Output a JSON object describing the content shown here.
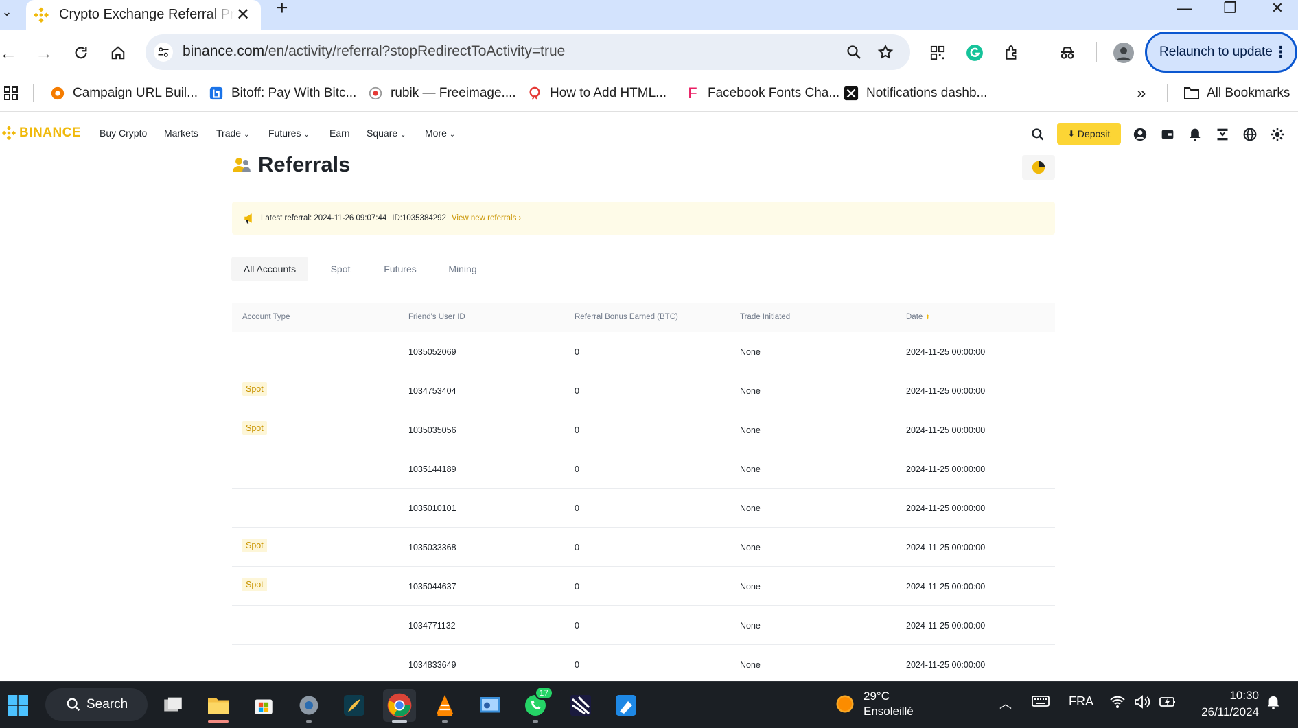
{
  "browser": {
    "tab_title": "Crypto Exchange Referral Program",
    "url_host": "binance.com",
    "url_path": "/en/activity/referral?stopRedirectToActivity=true",
    "relaunch_label": "Relaunch to update",
    "bookmarks": [
      {
        "label": "Campaign URL Buil...",
        "icon": "campaign-icon"
      },
      {
        "label": "Bitoff: Pay With Bitc...",
        "icon": "bitoff-icon"
      },
      {
        "label": "rubik — Freeimage....",
        "icon": "freeimage-icon"
      },
      {
        "label": "How to Add HTML...",
        "icon": "html-icon"
      },
      {
        "label": "Facebook Fonts Cha...",
        "icon": "fonts-icon"
      },
      {
        "label": "Notifications dashb...",
        "icon": "notifications-icon"
      }
    ],
    "all_bookmarks_label": "All Bookmarks"
  },
  "site": {
    "logo_text": "BINANCE",
    "nav": {
      "buy_crypto": "Buy Crypto",
      "markets": "Markets",
      "trade": "Trade",
      "futures": "Futures",
      "earn": "Earn",
      "square": "Square",
      "more": "More"
    },
    "deposit_label": "Deposit",
    "accent": "#f0b90b"
  },
  "page": {
    "title": "Referrals",
    "banner": {
      "text": "Latest referral: 2024-11-26 09:07:44",
      "id": "ID:1035384292",
      "link": "View new referrals"
    },
    "tabs": [
      "All Accounts",
      "Spot",
      "Futures",
      "Mining"
    ],
    "active_tab": "All Accounts",
    "table": {
      "headers": [
        "Account Type",
        "Friend's User ID",
        "Referral Bonus Earned (BTC)",
        "Trade Initiated",
        "Date"
      ],
      "rows": [
        {
          "type": "",
          "user_id": "1035052069",
          "bonus": "0",
          "trade": "None",
          "date": "2024-11-25 00:00:00"
        },
        {
          "type": "Spot",
          "user_id": "1034753404",
          "bonus": "0",
          "trade": "None",
          "date": "2024-11-25 00:00:00"
        },
        {
          "type": "Spot",
          "user_id": "1035035056",
          "bonus": "0",
          "trade": "None",
          "date": "2024-11-25 00:00:00"
        },
        {
          "type": "",
          "user_id": "1035144189",
          "bonus": "0",
          "trade": "None",
          "date": "2024-11-25 00:00:00"
        },
        {
          "type": "",
          "user_id": "1035010101",
          "bonus": "0",
          "trade": "None",
          "date": "2024-11-25 00:00:00"
        },
        {
          "type": "Spot",
          "user_id": "1035033368",
          "bonus": "0",
          "trade": "None",
          "date": "2024-11-25 00:00:00"
        },
        {
          "type": "Spot",
          "user_id": "1035044637",
          "bonus": "0",
          "trade": "None",
          "date": "2024-11-25 00:00:00"
        },
        {
          "type": "",
          "user_id": "1034771132",
          "bonus": "0",
          "trade": "None",
          "date": "2024-11-25 00:00:00"
        },
        {
          "type": "",
          "user_id": "1034833649",
          "bonus": "0",
          "trade": "None",
          "date": "2024-11-25 00:00:00"
        }
      ]
    }
  },
  "taskbar": {
    "search_label": "Search",
    "weather_temp": "29°C",
    "weather_desc": "Ensoleillé",
    "language": "FRA",
    "time": "10:30",
    "date": "26/11/2024",
    "whatsapp_badge": "17"
  }
}
